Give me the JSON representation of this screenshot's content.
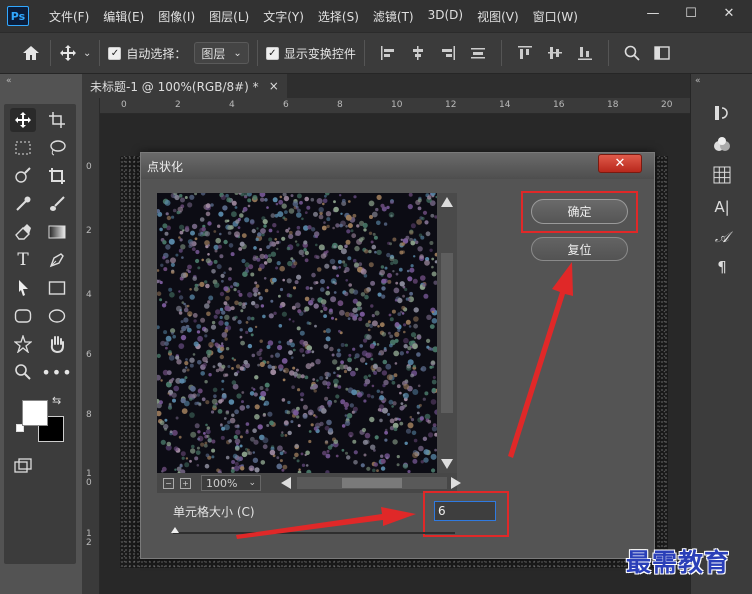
{
  "app": {
    "logo_text": "Ps"
  },
  "menu": {
    "items": [
      "文件(F)",
      "编辑(E)",
      "图像(I)",
      "图层(L)",
      "文字(Y)",
      "选择(S)",
      "滤镜(T)",
      "3D(D)",
      "视图(V)",
      "窗口(W)"
    ]
  },
  "window_controls": {
    "minimize": "—",
    "maximize": "☐",
    "close": "✕"
  },
  "options_bar": {
    "auto_select_label": "自动选择：",
    "auto_select_checked": true,
    "layer_select_value": "图层",
    "show_transform_label": "显示变换控件",
    "show_transform_checked": true
  },
  "document": {
    "tab_title": "未标题-1 @ 100%(RGB/8#) *",
    "close_glyph": "×"
  },
  "rulers": {
    "top_ticks": [
      "0",
      "2",
      "4",
      "6",
      "8",
      "10",
      "12",
      "14",
      "16",
      "18",
      "20"
    ],
    "left_ticks": [
      "0",
      "2",
      "4",
      "6",
      "8",
      "1\n0",
      "1\n2"
    ]
  },
  "dialog": {
    "title": "点状化",
    "close_glyph": "✕",
    "ok_label": "确定",
    "reset_label": "复位",
    "zoom_value": "100%",
    "cell_size_label": "单元格大小 (C)",
    "cell_size_value": "6",
    "slider_fraction": 0.0
  },
  "right_panel": {
    "icons": [
      "history-icon",
      "color-icon",
      "swatches-icon",
      "character-icon",
      "glyph-icon",
      "paragraph-icon"
    ]
  },
  "watermark": {
    "text": "最需教育"
  },
  "colors": {
    "annotation_red": "#e02828",
    "watermark_blue": "#2a3fb8",
    "input_focus": "#2f7ae0"
  }
}
